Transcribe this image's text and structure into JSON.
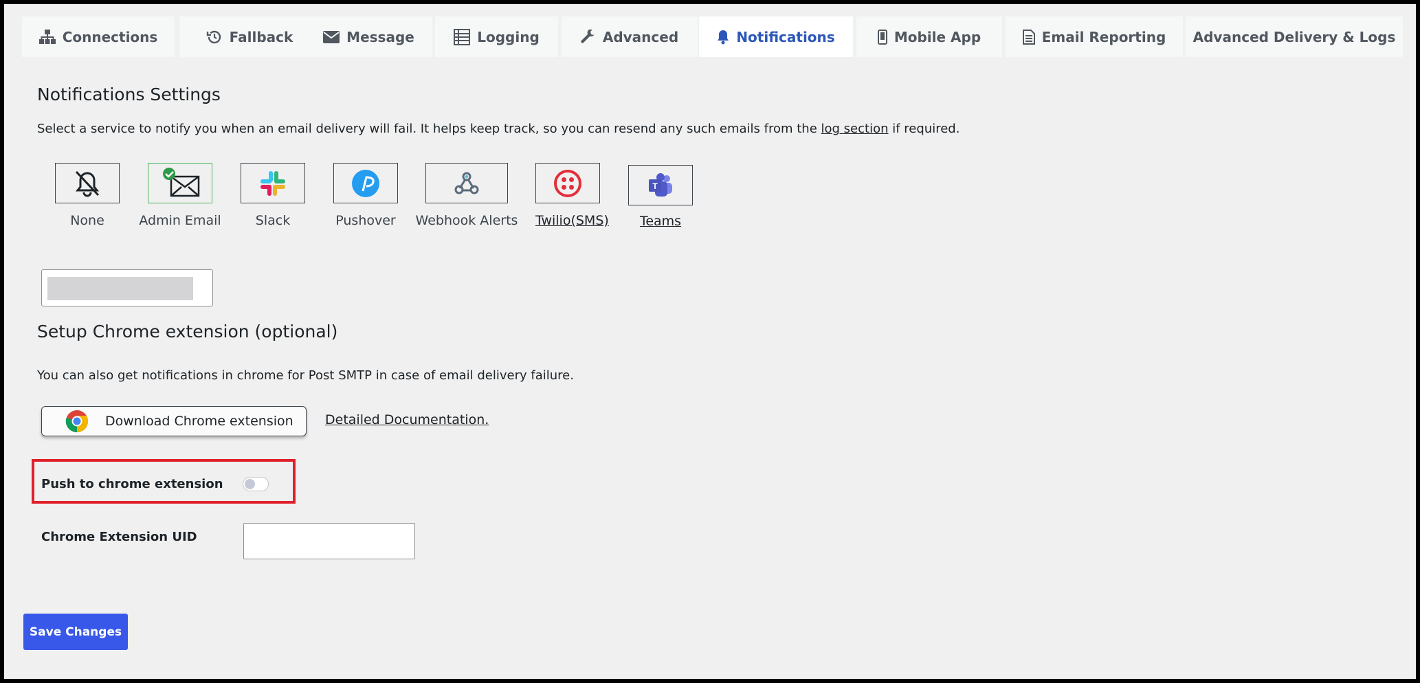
{
  "tabs": [
    {
      "label": "Connections",
      "icon": "sitemap-icon"
    },
    {
      "label": "Fallback",
      "icon": "history-icon"
    },
    {
      "label": "Message",
      "icon": "envelope-icon"
    },
    {
      "label": "Logging",
      "icon": "list-icon"
    },
    {
      "label": "Advanced",
      "icon": "wrench-icon"
    },
    {
      "label": "Notifications",
      "icon": "bell-icon",
      "active": true
    },
    {
      "label": "Mobile App",
      "icon": "mobile-icon"
    },
    {
      "label": "Email Reporting",
      "icon": "document-icon"
    },
    {
      "label": "Advanced Delivery & Logs",
      "icon": ""
    }
  ],
  "notifications": {
    "title": "Notifications Settings",
    "desc_before": "Select a service to notify you when an email delivery will fail. It helps keep track, so you can resend any such emails from the ",
    "desc_link": "log section",
    "desc_after": " if required.",
    "services": [
      {
        "label": "None",
        "icon": "bell-off-icon"
      },
      {
        "label": "Admin Email",
        "icon": "envelope-check-icon",
        "selected": true
      },
      {
        "label": "Slack",
        "icon": "slack-icon"
      },
      {
        "label": "Pushover",
        "icon": "pushover-icon"
      },
      {
        "label": "Webhook Alerts",
        "icon": "webhook-icon"
      },
      {
        "label": "Twilio(SMS)",
        "icon": "twilio-icon"
      },
      {
        "label": "Teams",
        "icon": "teams-icon"
      }
    ]
  },
  "chrome": {
    "title": "Setup Chrome extension (optional)",
    "desc": "You can also get notifications in chrome for Post SMTP in case of email delivery failure.",
    "download_label": "Download Chrome extension",
    "doc_link": "Detailed Documentation.",
    "push_label": "Push to chrome extension",
    "push_enabled": false,
    "uid_label": "Chrome Extension UID",
    "uid_value": ""
  },
  "colors": {
    "accent": "#3858e9",
    "active_tab": "#2c56b8",
    "highlight": "#e0212b",
    "selected_border": "#48b35a"
  },
  "save_label": "Save Changes"
}
